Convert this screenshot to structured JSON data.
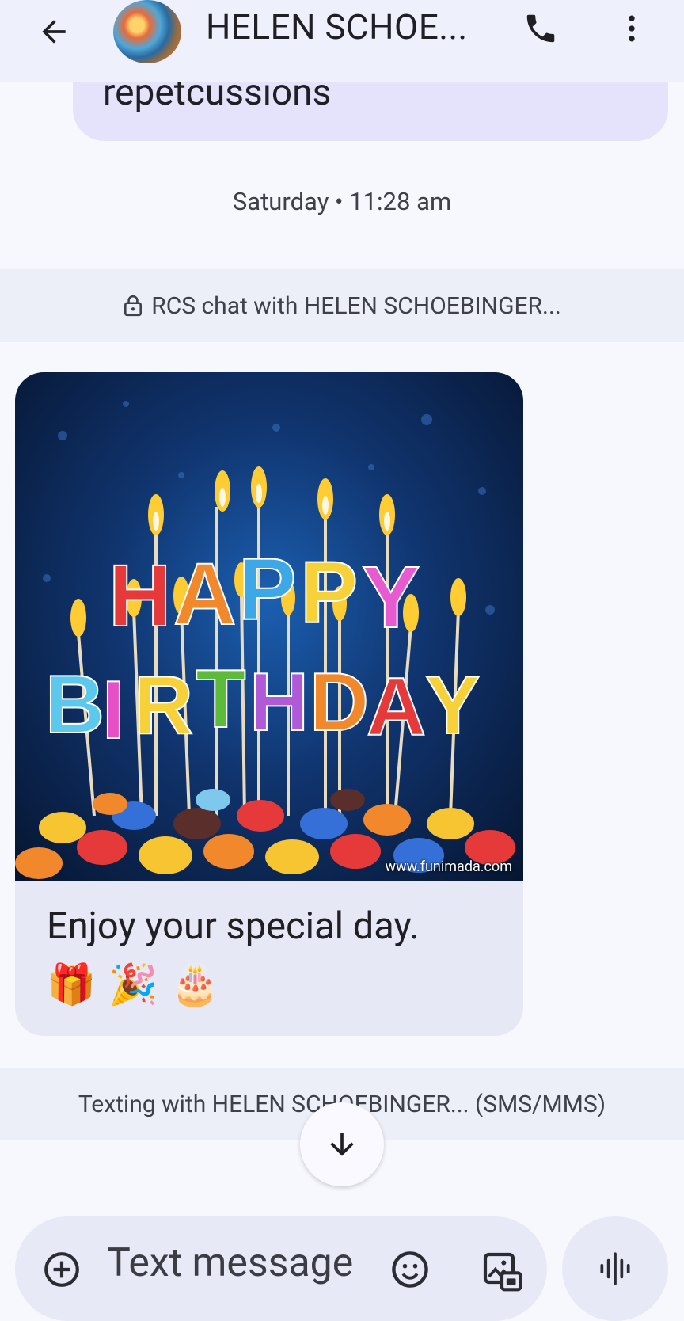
{
  "header": {
    "contact_name": "HELEN SCHOE...",
    "back_icon": "arrow-left-icon",
    "call_icon": "phone-icon",
    "menu_icon": "more-vert-icon"
  },
  "previous_message": {
    "text": "repetcussions"
  },
  "timestamp": "Saturday • 11:28 am",
  "rcs_banner": {
    "text": "RCS chat with HELEN SCHOEBINGER...",
    "icon": "lock-icon"
  },
  "message": {
    "image": {
      "alt_words": [
        "HAPPY",
        "BIRTHDAY"
      ],
      "watermark": "www.funimada.com"
    },
    "text": "Enjoy your special day.",
    "emoji": "🎁 🎉 🎂"
  },
  "sms_banner": {
    "text": "Texting with HELEN SCHOEBINGER... (SMS/MMS)"
  },
  "compose": {
    "placeholder": "Text message",
    "plus_icon": "add-circle-icon",
    "emoji_icon": "emoji-icon",
    "gallery_icon": "gallery-icon",
    "voice_icon": "voice-wave-icon"
  },
  "colors": {
    "background": "#f7f8fe",
    "topbar": "#eef0fb",
    "bubble_outgoing": "#e4e3fb",
    "bubble_incoming": "#e6e8f5"
  }
}
